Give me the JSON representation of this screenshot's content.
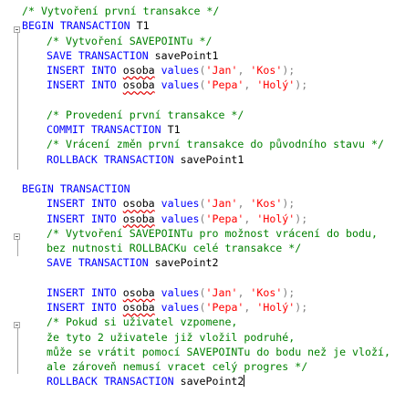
{
  "lines": [
    {
      "id": "l1",
      "indent": 0,
      "tokens": [
        {
          "t": "cm",
          "v": "/* Vytvoření první transakce */"
        }
      ]
    },
    {
      "id": "l2",
      "indent": 0,
      "tokens": [
        {
          "t": "kw",
          "v": "BEGIN TRANSACTION"
        },
        {
          "t": "id",
          "v": " T1"
        }
      ]
    },
    {
      "id": "l3",
      "indent": 1,
      "tokens": [
        {
          "t": "cm",
          "v": "/* Vytvoření SAVEPOINTu */"
        }
      ]
    },
    {
      "id": "l4",
      "indent": 1,
      "tokens": [
        {
          "t": "kw",
          "v": "SAVE TRANSACTION"
        },
        {
          "t": "id",
          "v": " savePoint1"
        }
      ]
    },
    {
      "id": "l5",
      "indent": 1,
      "tokens": [
        {
          "t": "kw",
          "v": "INSERT INTO"
        },
        {
          "t": "id",
          "v": " "
        },
        {
          "t": "sq",
          "v": "osoba"
        },
        {
          "t": "kw",
          "v": " values"
        },
        {
          "t": "gr",
          "v": "("
        },
        {
          "t": "str",
          "v": "'Jan'"
        },
        {
          "t": "gr",
          "v": ", "
        },
        {
          "t": "str",
          "v": "'Kos'"
        },
        {
          "t": "gr",
          "v": ");"
        }
      ]
    },
    {
      "id": "l6",
      "indent": 1,
      "tokens": [
        {
          "t": "kw",
          "v": "INSERT INTO"
        },
        {
          "t": "id",
          "v": " "
        },
        {
          "t": "sq",
          "v": "osoba"
        },
        {
          "t": "kw",
          "v": " values"
        },
        {
          "t": "gr",
          "v": "("
        },
        {
          "t": "str",
          "v": "'Pepa'"
        },
        {
          "t": "gr",
          "v": ", "
        },
        {
          "t": "str",
          "v": "'Holý'"
        },
        {
          "t": "gr",
          "v": ");"
        }
      ]
    },
    {
      "id": "l7",
      "indent": 0,
      "tokens": []
    },
    {
      "id": "l8",
      "indent": 1,
      "tokens": [
        {
          "t": "cm",
          "v": "/* Provedení první transakce */"
        }
      ]
    },
    {
      "id": "l9",
      "indent": 1,
      "tokens": [
        {
          "t": "kw",
          "v": "COMMIT TRANSACTION"
        },
        {
          "t": "id",
          "v": " T1"
        }
      ]
    },
    {
      "id": "l10",
      "indent": 1,
      "tokens": [
        {
          "t": "cm",
          "v": "/* Vrácení změn první transakce do původního stavu */"
        }
      ]
    },
    {
      "id": "l11",
      "indent": 1,
      "tokens": [
        {
          "t": "kw",
          "v": "ROLLBACK TRANSACTION"
        },
        {
          "t": "id",
          "v": " savePoint1"
        }
      ]
    },
    {
      "id": "l12",
      "indent": 0,
      "tokens": []
    },
    {
      "id": "l13",
      "indent": 0,
      "tokens": [
        {
          "t": "kw",
          "v": "BEGIN TRANSACTION"
        }
      ]
    },
    {
      "id": "l14",
      "indent": 1,
      "tokens": [
        {
          "t": "kw",
          "v": "INSERT INTO"
        },
        {
          "t": "id",
          "v": " "
        },
        {
          "t": "sq",
          "v": "osoba"
        },
        {
          "t": "kw",
          "v": " values"
        },
        {
          "t": "gr",
          "v": "("
        },
        {
          "t": "str",
          "v": "'Jan'"
        },
        {
          "t": "gr",
          "v": ", "
        },
        {
          "t": "str",
          "v": "'Kos'"
        },
        {
          "t": "gr",
          "v": ");"
        }
      ]
    },
    {
      "id": "l15",
      "indent": 1,
      "tokens": [
        {
          "t": "kw",
          "v": "INSERT INTO"
        },
        {
          "t": "id",
          "v": " "
        },
        {
          "t": "sq",
          "v": "osoba"
        },
        {
          "t": "kw",
          "v": " values"
        },
        {
          "t": "gr",
          "v": "("
        },
        {
          "t": "str",
          "v": "'Pepa'"
        },
        {
          "t": "gr",
          "v": ", "
        },
        {
          "t": "str",
          "v": "'Holý'"
        },
        {
          "t": "gr",
          "v": ");"
        }
      ]
    },
    {
      "id": "l16",
      "indent": 1,
      "tokens": [
        {
          "t": "cm",
          "v": "/* Vytvoření SAVEPOINTu pro možnost vrácení do bodu,"
        }
      ]
    },
    {
      "id": "l17",
      "indent": 1,
      "tokens": [
        {
          "t": "cm",
          "v": "bez nutnosti ROLLBACKu celé transakce */"
        }
      ]
    },
    {
      "id": "l18",
      "indent": 1,
      "tokens": [
        {
          "t": "kw",
          "v": "SAVE TRANSACTION"
        },
        {
          "t": "id",
          "v": " savePoint2"
        }
      ]
    },
    {
      "id": "l19",
      "indent": 0,
      "tokens": []
    },
    {
      "id": "l20",
      "indent": 1,
      "tokens": [
        {
          "t": "kw",
          "v": "INSERT INTO"
        },
        {
          "t": "id",
          "v": " "
        },
        {
          "t": "sq",
          "v": "osoba"
        },
        {
          "t": "kw",
          "v": " values"
        },
        {
          "t": "gr",
          "v": "("
        },
        {
          "t": "str",
          "v": "'Jan'"
        },
        {
          "t": "gr",
          "v": ", "
        },
        {
          "t": "str",
          "v": "'Kos'"
        },
        {
          "t": "gr",
          "v": ");"
        }
      ]
    },
    {
      "id": "l21",
      "indent": 1,
      "tokens": [
        {
          "t": "kw",
          "v": "INSERT INTO"
        },
        {
          "t": "id",
          "v": " "
        },
        {
          "t": "sq",
          "v": "osoba"
        },
        {
          "t": "kw",
          "v": " values"
        },
        {
          "t": "gr",
          "v": "("
        },
        {
          "t": "str",
          "v": "'Pepa'"
        },
        {
          "t": "gr",
          "v": ", "
        },
        {
          "t": "str",
          "v": "'Holý'"
        },
        {
          "t": "gr",
          "v": ");"
        }
      ]
    },
    {
      "id": "l22",
      "indent": 1,
      "tokens": [
        {
          "t": "cm",
          "v": "/* Pokud si uživatel vzpomene,"
        }
      ]
    },
    {
      "id": "l23",
      "indent": 1,
      "tokens": [
        {
          "t": "cm",
          "v": "že tyto 2 uživatele již vložil podruhé,"
        }
      ]
    },
    {
      "id": "l24",
      "indent": 1,
      "tokens": [
        {
          "t": "cm",
          "v": "může se vrátit pomocí SAVEPOINTu do bodu než je vloží,"
        }
      ]
    },
    {
      "id": "l25",
      "indent": 1,
      "tokens": [
        {
          "t": "cm",
          "v": "ale zároveň nemusí vracet celý progres */"
        }
      ]
    },
    {
      "id": "l26",
      "indent": 1,
      "tokens": [
        {
          "t": "kw",
          "v": "ROLLBACK TRANSACTION"
        },
        {
          "t": "id",
          "v": " savePoint2"
        }
      ],
      "caret": true
    }
  ],
  "colors": {
    "keyword": "#0000ff",
    "comment": "#008000",
    "string": "#ff0000",
    "punctuation": "#808080",
    "squiggle": "#e00000"
  },
  "icons": [
    "fold-collapse-icon"
  ]
}
